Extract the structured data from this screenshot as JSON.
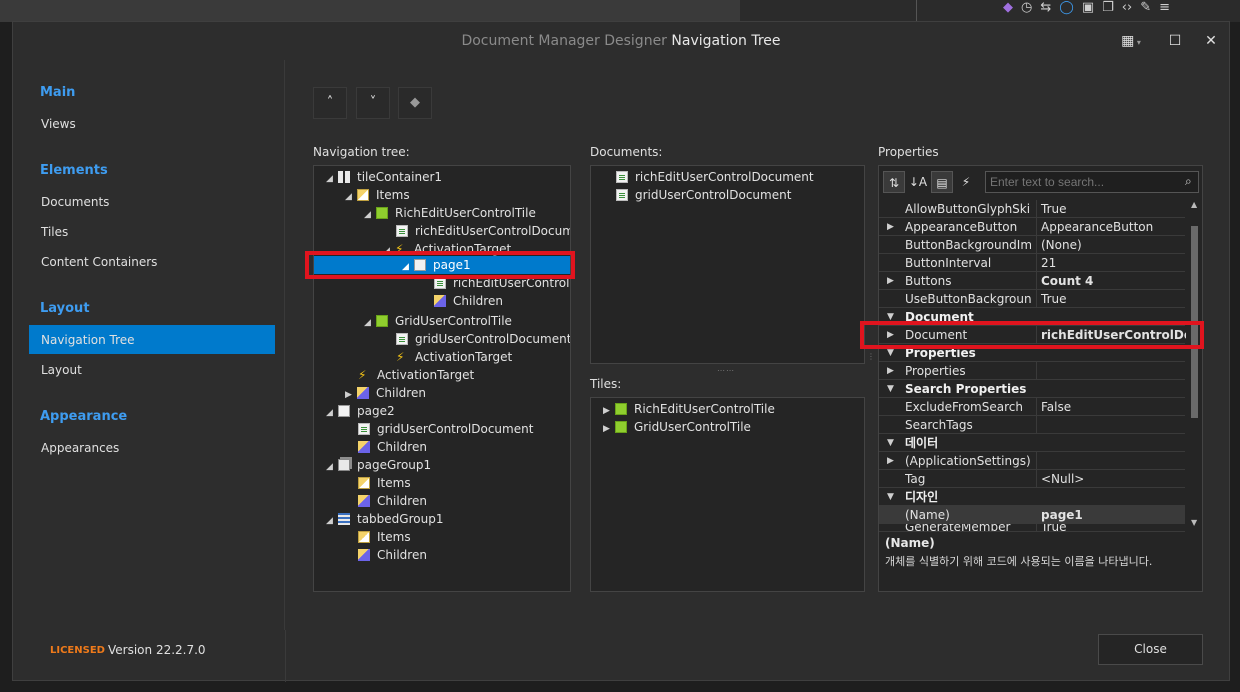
{
  "window": {
    "title_prefix": "Document Manager Designer",
    "title_main": "Navigation Tree"
  },
  "sidebar": {
    "sections": [
      {
        "heading": "Main",
        "items": [
          "Views"
        ]
      },
      {
        "heading": "Elements",
        "items": [
          "Documents",
          "Tiles",
          "Content Containers"
        ]
      },
      {
        "heading": "Layout",
        "items": [
          "Navigation Tree",
          "Layout"
        ]
      },
      {
        "heading": "Appearance",
        "items": [
          "Appearances"
        ]
      }
    ],
    "selected": "Navigation Tree"
  },
  "toolbar": {
    "up_glyph": "˄",
    "down_glyph": "˅",
    "clear_icon": "eraser-icon"
  },
  "nav_tree": {
    "label": "Navigation tree:",
    "rows": [
      {
        "text": "tileContainer1",
        "icon": "grid"
      },
      {
        "text": "Items",
        "icon": "items"
      },
      {
        "text": "RichEditUserControlTile",
        "icon": "green"
      },
      {
        "text": "richEditUserControlDocumen",
        "icon": "doc"
      },
      {
        "text": "ActivationTarget",
        "icon": "bolt"
      },
      {
        "text": "page1",
        "icon": "page"
      },
      {
        "text": "richEditUserControlDo",
        "icon": "doc"
      },
      {
        "text": "Children",
        "icon": "children"
      },
      {
        "text": "GridUserControlTile",
        "icon": "green"
      },
      {
        "text": "gridUserControlDocument",
        "icon": "doc"
      },
      {
        "text": "ActivationTarget",
        "icon": "bolt"
      },
      {
        "text": "ActivationTarget",
        "icon": "bolt"
      },
      {
        "text": "Children",
        "icon": "children"
      },
      {
        "text": "page2",
        "icon": "page"
      },
      {
        "text": "gridUserControlDocument",
        "icon": "doc"
      },
      {
        "text": "Children",
        "icon": "children"
      },
      {
        "text": "pageGroup1",
        "icon": "group"
      },
      {
        "text": "Items",
        "icon": "items"
      },
      {
        "text": "Children",
        "icon": "children"
      },
      {
        "text": "tabbedGroup1",
        "icon": "tabbed"
      },
      {
        "text": "Items",
        "icon": "items"
      },
      {
        "text": "Children",
        "icon": "children"
      }
    ]
  },
  "documents": {
    "label": "Documents:",
    "items": [
      "richEditUserControlDocument",
      "gridUserControlDocument"
    ]
  },
  "tiles": {
    "label": "Tiles:",
    "items": [
      "RichEditUserControlTile",
      "GridUserControlTile"
    ]
  },
  "properties": {
    "label": "Properties",
    "search_placeholder": "Enter text to search...",
    "rows": [
      {
        "name": "AllowButtonGlyphSkinn",
        "value": "True"
      },
      {
        "name": "AppearanceButton",
        "value": "AppearanceButton"
      },
      {
        "name": "ButtonBackgroundImag",
        "value": "(None)"
      },
      {
        "name": "ButtonInterval",
        "value": "21"
      },
      {
        "name": "Buttons",
        "value": "Count 4"
      },
      {
        "name": "UseButtonBackgroundI",
        "value": "True"
      },
      {
        "name": "Document",
        "value": ""
      },
      {
        "name": "Document",
        "value": "richEditUserControlDocu"
      },
      {
        "name": "Properties",
        "value": ""
      },
      {
        "name": "Properties",
        "value": ""
      },
      {
        "name": "Search Properties",
        "value": ""
      },
      {
        "name": "ExcludeFromSearch",
        "value": "False"
      },
      {
        "name": "SearchTags",
        "value": ""
      },
      {
        "name": "데이터",
        "value": ""
      },
      {
        "name": "(ApplicationSettings)",
        "value": ""
      },
      {
        "name": "Tag",
        "value": "<Null>"
      },
      {
        "name": "디자인",
        "value": ""
      },
      {
        "name": "(Name)",
        "value": "page1"
      },
      {
        "name": "GenerateMember",
        "value": "True"
      }
    ],
    "description_title": "(Name)",
    "description_text": "개체를 식별하기 위해 코드에 사용되는 이름을 나타냅니다."
  },
  "footer": {
    "licensed": "LICENSED",
    "version": "Version 22.2.7.0",
    "close_label": "Close"
  }
}
